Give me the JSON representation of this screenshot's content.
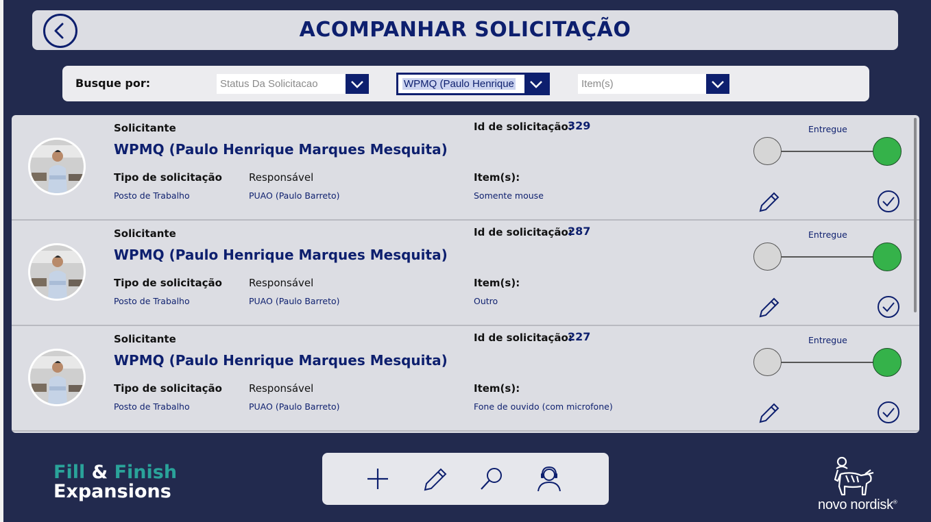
{
  "header": {
    "title": "ACOMPANHAR SOLICITAÇÃO"
  },
  "filters": {
    "label": "Busque por:",
    "status_placeholder": "Status Da Solicitacao",
    "requester_value": "WPMQ (Paulo Henrique",
    "items_placeholder": "Item(s)"
  },
  "labels": {
    "requester": "Solicitante",
    "request_id": "Id de solicitação:",
    "request_type": "Tipo de solicitação",
    "responsible": "Responsável",
    "items": "Item(s):"
  },
  "requests": [
    {
      "requester_name": "WPMQ (Paulo Henrique Marques Mesquita)",
      "id": "329",
      "type": "Posto de Trabalho",
      "responsible": "PUAO (Paulo Barreto)",
      "items": "Somente mouse",
      "status": "Entregue"
    },
    {
      "requester_name": "WPMQ (Paulo Henrique Marques Mesquita)",
      "id": "287",
      "type": "Posto de Trabalho",
      "responsible": "PUAO (Paulo Barreto)",
      "items": "Outro",
      "status": "Entregue"
    },
    {
      "requester_name": "WPMQ (Paulo Henrique Marques Mesquita)",
      "id": "227",
      "type": "Posto de Trabalho",
      "responsible": "PUAO (Paulo Barreto)",
      "items": "Fone de ouvido (com microfone)",
      "status": "Entregue"
    }
  ],
  "branding": {
    "line1_a": "Fill",
    "line1_amp": "&",
    "line1_b": "Finish",
    "line2": "Expansions",
    "company": "novo nordisk",
    "registered": "®"
  },
  "colors": {
    "background": "#222a4e",
    "accent": "#0d1f6e",
    "status_on": "#35b24a",
    "brand_teal": "#2aa39a"
  },
  "icons": {
    "back": "arrow-left-circle-icon",
    "dropdown": "chevron-down-icon",
    "edit": "pencil-icon",
    "confirm": "check-circle-icon",
    "add": "plus-icon",
    "search": "search-icon",
    "support": "headset-user-icon"
  }
}
